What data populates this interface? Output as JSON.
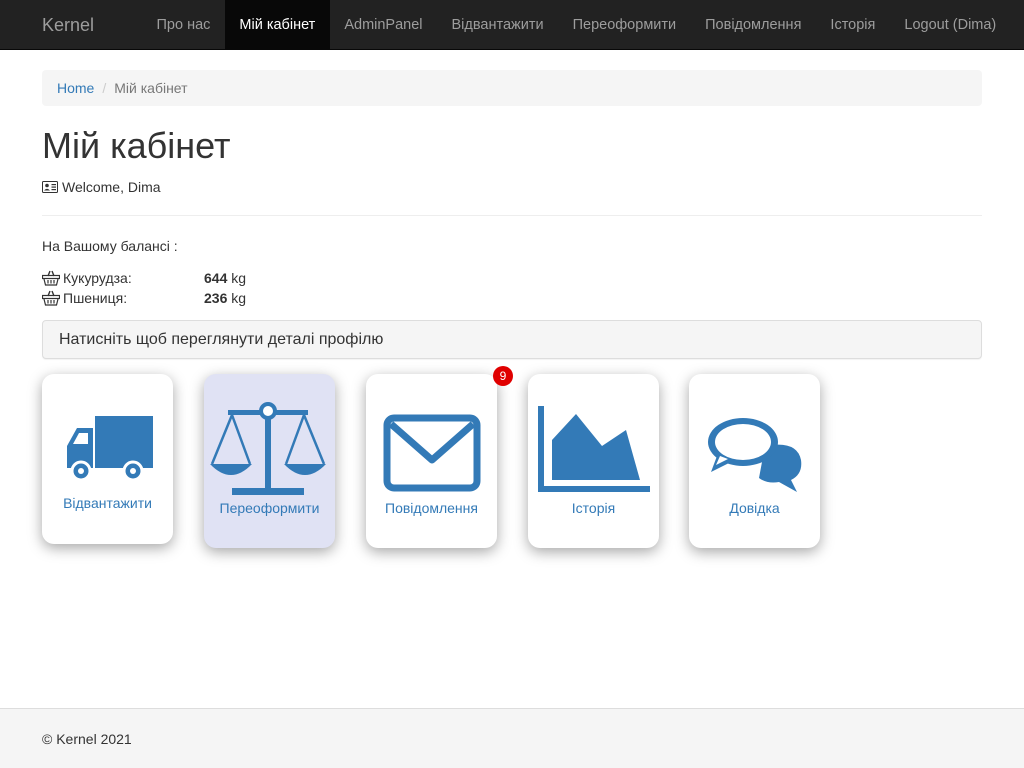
{
  "navbar": {
    "brand": "Kernel",
    "items": [
      {
        "label": "Про нас"
      },
      {
        "label": "Мій кабінет",
        "active": true
      },
      {
        "label": "AdminPanel"
      },
      {
        "label": "Відвантажити"
      },
      {
        "label": "Переоформити"
      },
      {
        "label": "Повідомлення"
      },
      {
        "label": "Історія"
      },
      {
        "label": "Logout (Dima)"
      }
    ]
  },
  "breadcrumb": {
    "home": "Home",
    "separator": "/",
    "current": "Мій кабінет"
  },
  "page": {
    "title": "Мій кабінет",
    "welcome": "Welcome, Dima",
    "balance_label": "На Вашому балансі :",
    "balances": [
      {
        "name": "Кукурудза:",
        "amount": "644",
        "unit": "kg"
      },
      {
        "name": "Пшениця:",
        "amount": "236",
        "unit": "kg"
      }
    ],
    "profile_panel": "Натисніть щоб переглянути деталі профілю"
  },
  "tiles": [
    {
      "label": "Відвантажити",
      "icon": "truck-icon"
    },
    {
      "label": "Переоформити",
      "icon": "scales-icon"
    },
    {
      "label": "Повідомлення",
      "icon": "envelope-icon",
      "badge": "9"
    },
    {
      "label": "Історія",
      "icon": "area-chart-icon"
    },
    {
      "label": "Довідка",
      "icon": "chat-bubbles-icon"
    }
  ],
  "footer": {
    "text": "© Kernel 2021"
  },
  "colors": {
    "accent": "#337ab7",
    "navbar": "#222222",
    "badge": "#e00000",
    "highlight_tile": "#e0e2f4"
  }
}
